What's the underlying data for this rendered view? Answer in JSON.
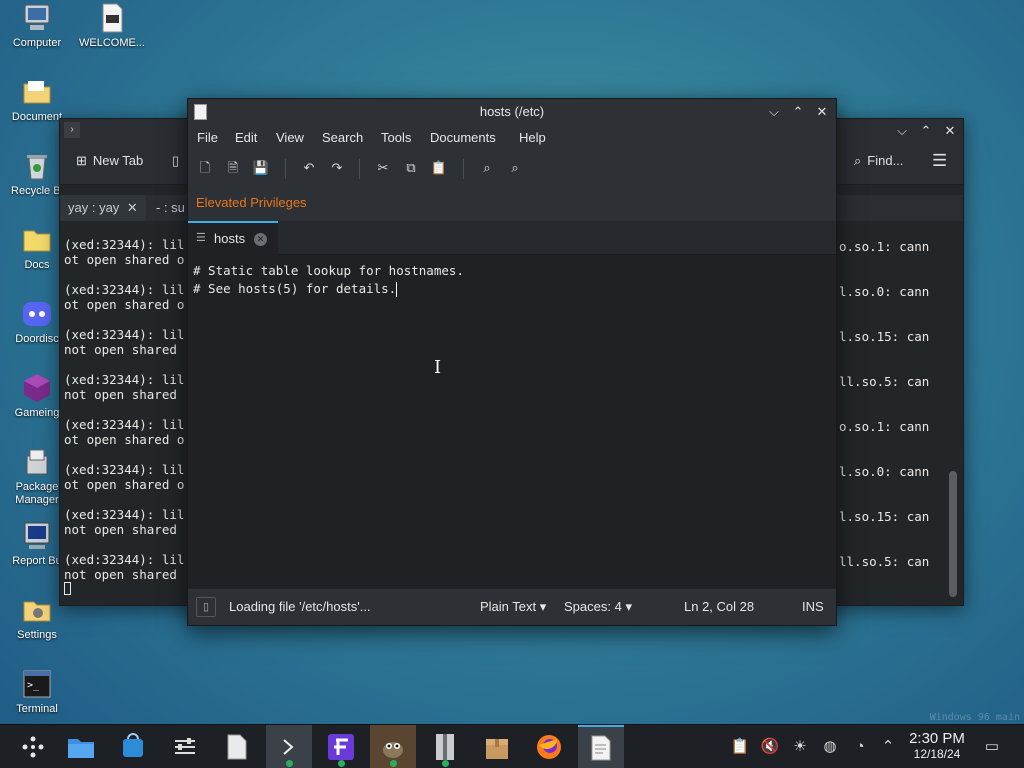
{
  "desktop": {
    "icons": [
      {
        "label": "Computer"
      },
      {
        "label": "WELCOME..."
      },
      {
        "label": "Document"
      },
      {
        "label": "Recycle Bi"
      },
      {
        "label": "Docs"
      },
      {
        "label": "Doordisc"
      },
      {
        "label": "Gameing"
      },
      {
        "label": "Package Manager"
      },
      {
        "label": "Report Bu"
      },
      {
        "label": "Settings"
      },
      {
        "label": "Terminal"
      }
    ],
    "watermark": "Windows 96 main"
  },
  "terminal": {
    "new_tab_label": "New Tab",
    "find_label": "Find...",
    "tabs": [
      "yay : yay",
      "- : su"
    ],
    "lines": [
      "(xed:32344): lil",
      "ot open shared o",
      "(xed:32344): lil",
      "ot open shared o",
      "(xed:32344): lil",
      "not open shared",
      "(xed:32344): lil",
      "not open shared",
      "(xed:32344): lil",
      "ot open shared o",
      "(xed:32344): lil",
      "ot open shared o",
      "(xed:32344): lil",
      "not open shared",
      "(xed:32344): lil",
      "not open shared"
    ],
    "right_lines": [
      "o.so.1: cann",
      "l.so.0: cann",
      "l.so.15: can",
      "ll.so.5: can",
      "o.so.1: cann",
      "l.so.0: cann",
      "l.so.15: can",
      "ll.so.5: can"
    ]
  },
  "editor": {
    "title": "hosts (/etc)",
    "menu": [
      "File",
      "Edit",
      "View",
      "Search",
      "Tools",
      "Documents",
      "Help"
    ],
    "elevated": "Elevated Privileges",
    "tab_label": "hosts",
    "content": [
      "# Static table lookup for hostnames.",
      "# See hosts(5) for details."
    ],
    "status": {
      "message": "Loading file '/etc/hosts'...",
      "syntax": "Plain Text",
      "spaces": "Spaces: 4",
      "position": "Ln 2, Col 28",
      "mode": "INS"
    },
    "accent": "#e8761a"
  },
  "taskbar": {
    "time": "2:30 PM",
    "date": "12/18/24"
  }
}
